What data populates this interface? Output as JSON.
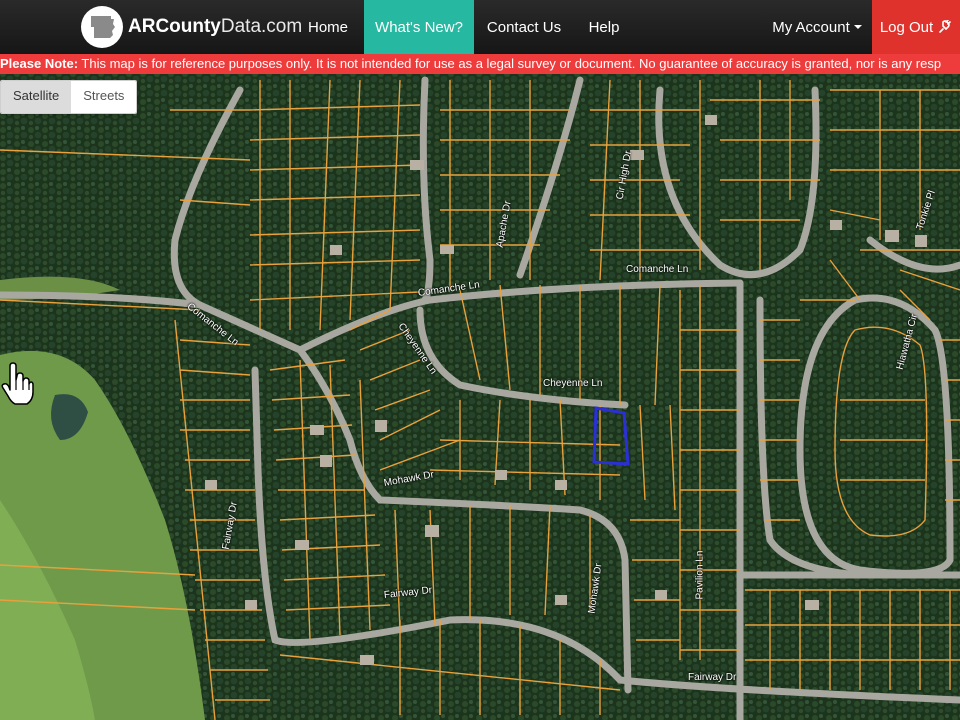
{
  "navbar": {
    "brand_bold": "ARCounty",
    "brand_rest": "Data.com",
    "home": "Home",
    "whats_new": "What's New?",
    "contact": "Contact Us",
    "help": "Help",
    "account": "My Account",
    "logout": "Log Out"
  },
  "notice": {
    "label": "Please Note:",
    "text": " This map is for reference purposes only. It is not intended for use as a legal survey or document. No guarantee of accuracy is granted, nor is any resp"
  },
  "map_type": {
    "satellite": "Satellite",
    "streets": "Streets"
  },
  "roads": [
    {
      "name": "Comanche Ln"
    },
    {
      "name": "Comanche Ln"
    },
    {
      "name": "Comanche Ln"
    },
    {
      "name": "Apache Dr"
    },
    {
      "name": "Cir High Dr"
    },
    {
      "name": "Cheyenne Ln"
    },
    {
      "name": "Cheyenne Ln"
    },
    {
      "name": "Mohawk Dr"
    },
    {
      "name": "Mohawk Dr"
    },
    {
      "name": "Fairway Dr"
    },
    {
      "name": "Fairway Dr"
    },
    {
      "name": "Fairway Dr"
    },
    {
      "name": "Pavilion Ln"
    },
    {
      "name": "Hiawatha Cir"
    },
    {
      "name": "Tonkie Pl"
    }
  ],
  "colors": {
    "accent": "#26b8a0",
    "logout": "#e0322d",
    "notice": "#ee3b3b",
    "parcel_lines": "#e8a13c",
    "selected_parcel": "#2a2fd6",
    "forest": "#1f3a1f",
    "fairway": "#6f9a4a"
  },
  "icons": {
    "brand": "arkansas-state-icon",
    "logout": "plug-icon",
    "pointer": "hand-pointer-icon"
  }
}
